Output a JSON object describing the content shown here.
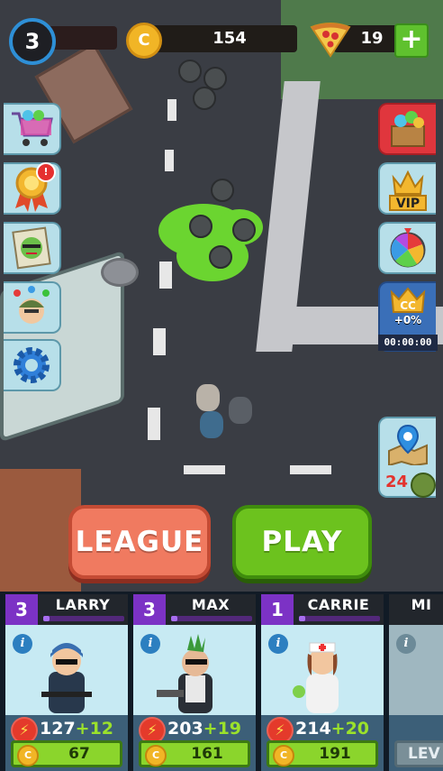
{
  "hud": {
    "player_level": "3",
    "coins": "154",
    "pizza": "19",
    "coin_icon_letter": "C",
    "plus_label": "+"
  },
  "left_menu": {
    "shop": "shop-cart-icon",
    "achievements": "medal-icon",
    "achievements_badge": "!",
    "missions": "zombie-poster-icon",
    "squad": "soldier-icon",
    "settings": "gear-icon"
  },
  "right_menu": {
    "chest": "gift-box-icon",
    "vip_label": "VIP",
    "spin": "prize-wheel-icon",
    "cc_label": "CC",
    "cc_bonus": "+0%",
    "cc_timer": "00:00:00",
    "map": "map-pin-icon",
    "map_count": "24"
  },
  "buttons": {
    "league": "LEAGUE",
    "play": "PLAY"
  },
  "cards": [
    {
      "level": "3",
      "name": "LARRY",
      "power_base": "127",
      "power_bonus": "+12",
      "cost": "67",
      "info": "i",
      "xp": 0.08
    },
    {
      "level": "3",
      "name": "MAX",
      "power_base": "203",
      "power_bonus": "+19",
      "cost": "161",
      "info": "i",
      "xp": 0.08
    },
    {
      "level": "1",
      "name": "CARRIE",
      "power_base": "214",
      "power_bonus": "+20",
      "cost": "191",
      "info": "i",
      "xp": 0.08
    },
    {
      "name": "MI",
      "info": "i",
      "upgrade_label": "LEV"
    }
  ],
  "colors": {
    "slime": "#6bd530",
    "league": "#f07a60",
    "play": "#6cc21e",
    "card_level": "#7c32c5"
  }
}
